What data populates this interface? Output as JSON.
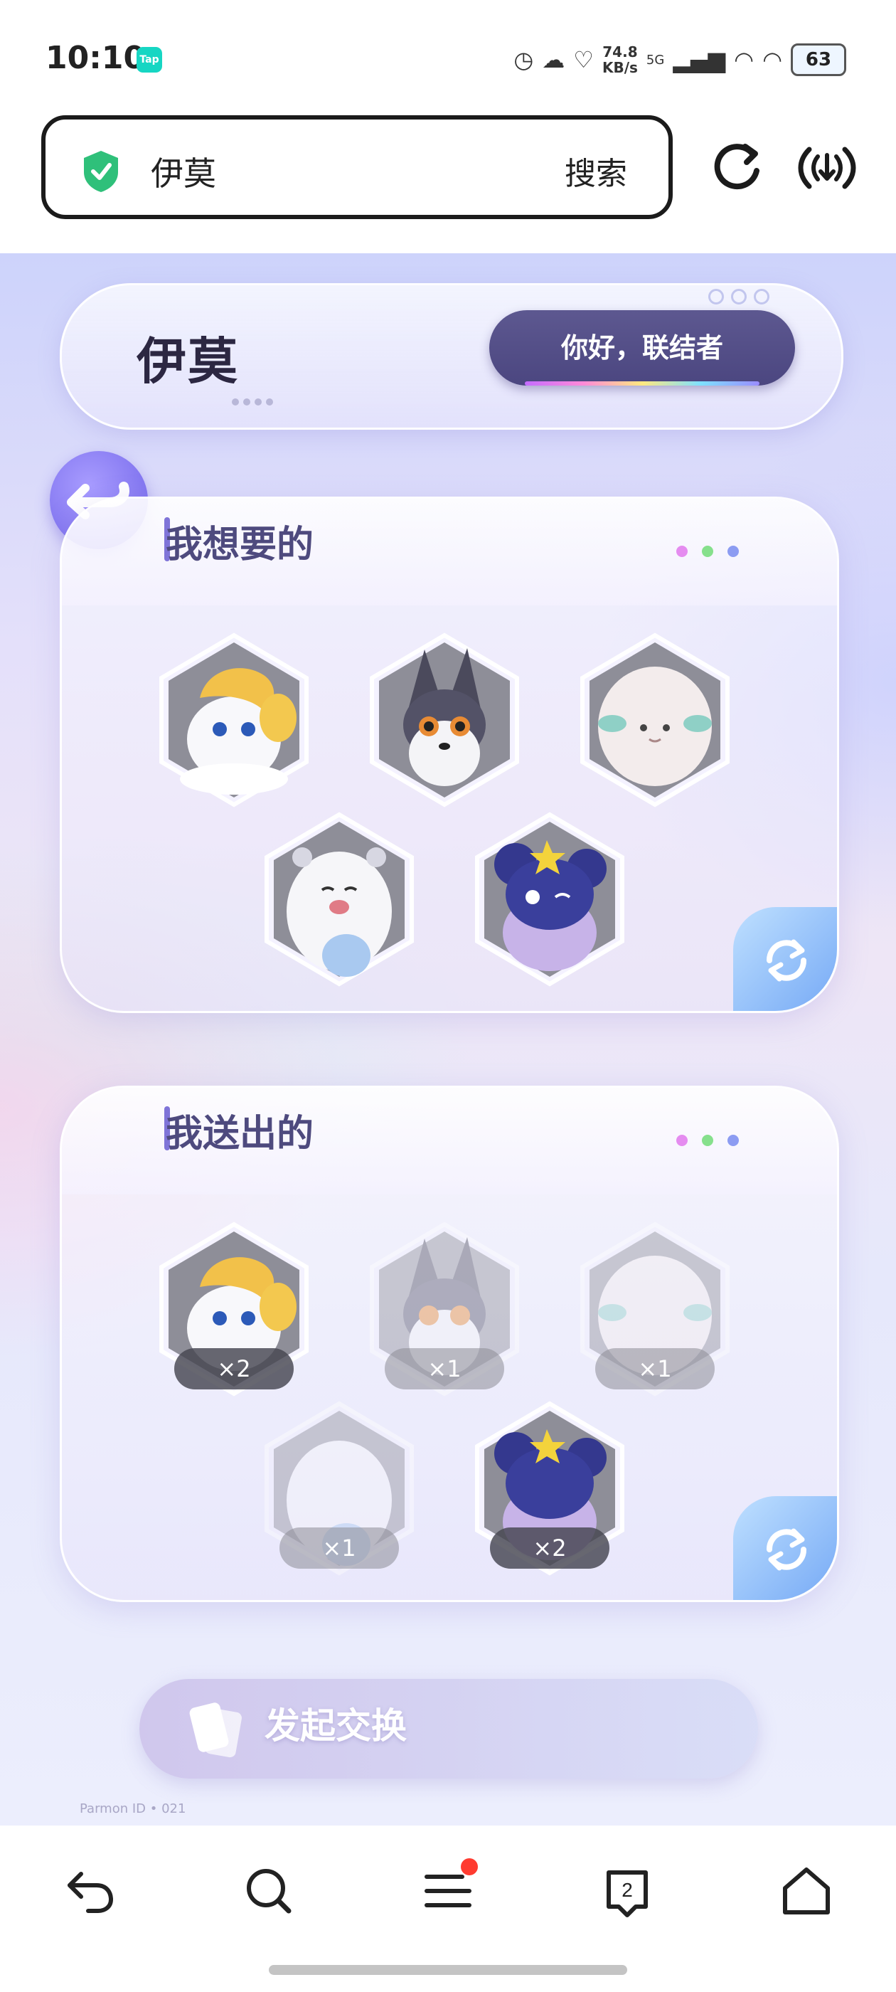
{
  "status_bar": {
    "time": "10:10",
    "tap_badge": "Tap",
    "net_speed_value": "74.8",
    "net_speed_unit": "KB/s",
    "net_type": "5G",
    "battery": "63"
  },
  "browser": {
    "url_text": "伊莫",
    "search_label": "搜索"
  },
  "page": {
    "logo_text": "伊莫",
    "greeting": "你好，联结者",
    "want_section": {
      "title": "我想要的",
      "items": [
        {
          "name": "golden-fluffy-pet"
        },
        {
          "name": "gray-fox-pet"
        },
        {
          "name": "white-sheep-pet"
        },
        {
          "name": "white-seal-pet"
        },
        {
          "name": "blue-mouse-pet"
        }
      ]
    },
    "give_section": {
      "title": "我送出的",
      "items": [
        {
          "name": "golden-fluffy-pet",
          "count": "×2",
          "available": true
        },
        {
          "name": "gray-fox-pet",
          "count": "×1",
          "available": false
        },
        {
          "name": "white-sheep-pet",
          "count": "×1",
          "available": false
        },
        {
          "name": "white-seal-pet",
          "count": "×1",
          "available": false
        },
        {
          "name": "blue-mouse-pet",
          "count": "×2",
          "available": true
        }
      ]
    },
    "start_button": "发起交换",
    "footer_code": "Parmon ID • 021"
  },
  "colors": {
    "accent_purple": "#7f74d8",
    "greeting_bg": "#4b4680",
    "dot_pink": "#e58cf0",
    "dot_green": "#86e08c",
    "dot_blue": "#8c9cf2",
    "notification": "#ff3b30"
  },
  "nav": {
    "icons": [
      "back-icon",
      "search-icon",
      "menu-icon",
      "tabs-icon",
      "home-icon"
    ],
    "tabs_count": "2"
  }
}
